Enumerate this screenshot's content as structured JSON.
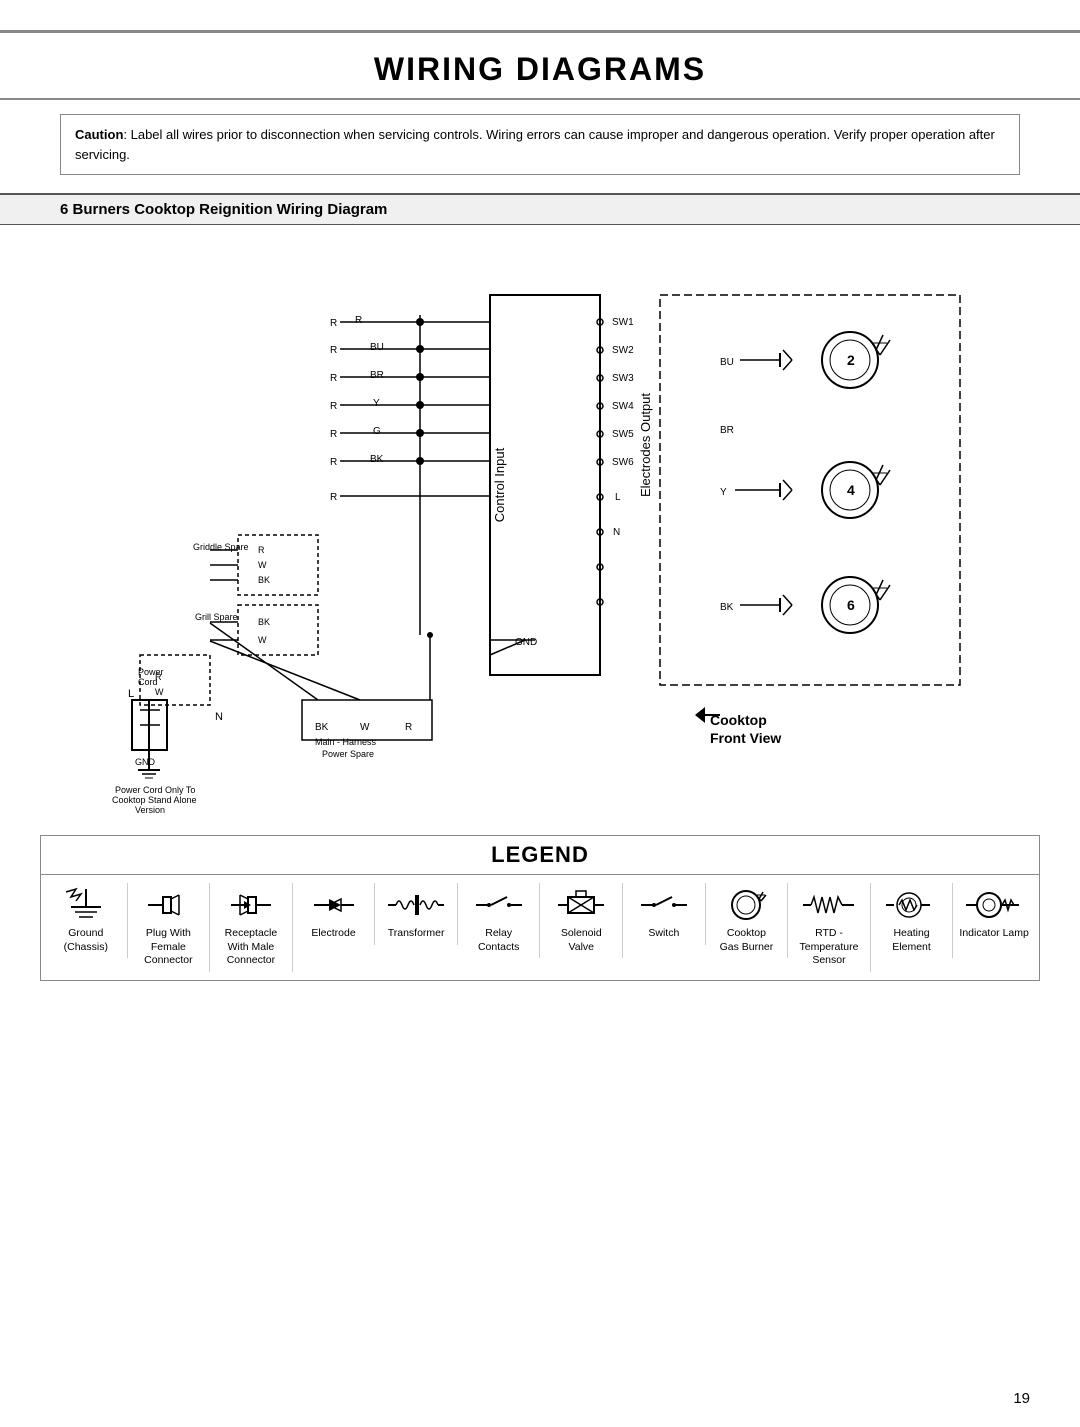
{
  "page": {
    "title": "WIRING DIAGRAMS",
    "page_number": "19"
  },
  "caution": {
    "label": "Caution",
    "text": ": Label all wires prior to disconnection when servicing controls. Wiring errors can cause improper and dangerous operation. Verify proper operation after servicing."
  },
  "section": {
    "title": "6 Burners Cooktop Reignition Wiring Diagram"
  },
  "diagram": {
    "cooktop_label": "Cooktop",
    "front_view_label": "Front View",
    "control_input_label": "Control Input",
    "electrodes_output_label": "Electrodes Output",
    "sw_labels": [
      "SW1",
      "SW2",
      "SW3",
      "SW4",
      "SW5",
      "SW6",
      "L",
      "N",
      "GND"
    ],
    "wire_colors": [
      "R",
      "BU",
      "BR",
      "Y",
      "G",
      "BK",
      "R",
      "BK",
      "BK",
      "W",
      "R",
      "W",
      "R",
      "W",
      "BK",
      "W",
      "R",
      "GND"
    ],
    "component_labels": [
      "Griddle Spare",
      "Grill Spare",
      "Power Cord",
      "Main - Harness Power Spare"
    ],
    "burner_labels": [
      "2",
      "4",
      "6"
    ]
  },
  "legend": {
    "title": "LEGEND",
    "items": [
      {
        "id": "ground",
        "label": "Ground\n(Chassis)"
      },
      {
        "id": "plug-female",
        "label": "Plug With\nFemale\nConnector"
      },
      {
        "id": "receptacle-male",
        "label": "Receptacle\nWith Male\nConnector"
      },
      {
        "id": "electrode",
        "label": "Electrode"
      },
      {
        "id": "transformer",
        "label": "Transformer"
      },
      {
        "id": "relay",
        "label": "Relay\nContacts"
      },
      {
        "id": "solenoid",
        "label": "Solenoid\nValve"
      },
      {
        "id": "switch",
        "label": "Switch"
      },
      {
        "id": "cooktop-gas-burner",
        "label": "Cooktop\nGas Burner"
      },
      {
        "id": "rtd",
        "label": "RTD -\nTemperature\nSensor"
      },
      {
        "id": "heating-element",
        "label": "Heating\nElement"
      },
      {
        "id": "indicator-lamp",
        "label": "Indicator Lamp"
      }
    ]
  }
}
